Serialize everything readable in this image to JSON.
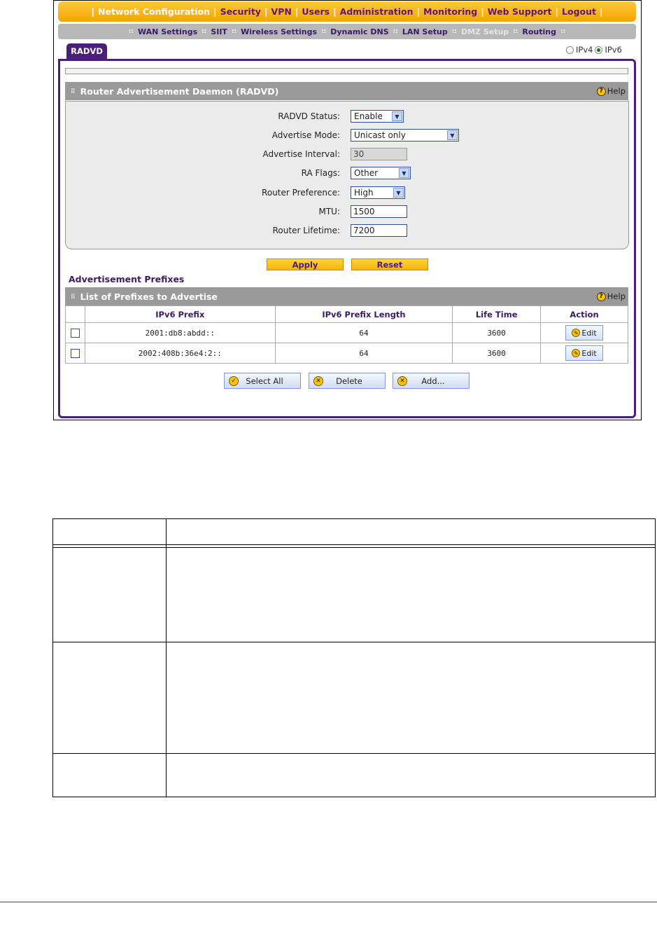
{
  "topnav": {
    "items": [
      "Network Configuration",
      "Security",
      "VPN",
      "Users",
      "Administration",
      "Monitoring",
      "Web Support",
      "Logout"
    ]
  },
  "subnav": {
    "items": [
      "WAN Settings",
      "SIIT",
      "Wireless Settings",
      "Dynamic DNS",
      "LAN Setup",
      "DMZ Setup",
      "Routing"
    ]
  },
  "tab": {
    "label": "RADVD"
  },
  "ip_version": {
    "ipv4": "IPv4",
    "ipv6": "IPv6",
    "selected": "IPv6"
  },
  "radvd": {
    "title": "Router Advertisement Daemon (RADVD)",
    "help": "Help",
    "fields": {
      "status": {
        "label": "RADVD Status:",
        "value": "Enable"
      },
      "mode": {
        "label": "Advertise Mode:",
        "value": "Unicast only"
      },
      "interval": {
        "label": "Advertise Interval:",
        "value": "30"
      },
      "flags": {
        "label": "RA Flags:",
        "value": "Other"
      },
      "preference": {
        "label": "Router Preference:",
        "value": "High"
      },
      "mtu": {
        "label": "MTU:",
        "value": "1500"
      },
      "lifetime": {
        "label": "Router Lifetime:",
        "value": "7200"
      }
    },
    "apply": "Apply",
    "reset": "Reset"
  },
  "prefixes": {
    "section_title": "Advertisement Prefixes",
    "list_title": "List of Prefixes to Advertise",
    "help": "Help",
    "columns": [
      "IPv6 Prefix",
      "IPv6 Prefix Length",
      "Life Time",
      "Action"
    ],
    "rows": [
      {
        "prefix": "2001:db8:abdd::",
        "length": "64",
        "lifetime": "3600",
        "action": "Edit"
      },
      {
        "prefix": "2002:408b:36e4:2::",
        "length": "64",
        "lifetime": "3600",
        "action": "Edit"
      }
    ],
    "buttons": {
      "select_all": "Select All",
      "delete": "Delete",
      "add": "Add..."
    }
  }
}
